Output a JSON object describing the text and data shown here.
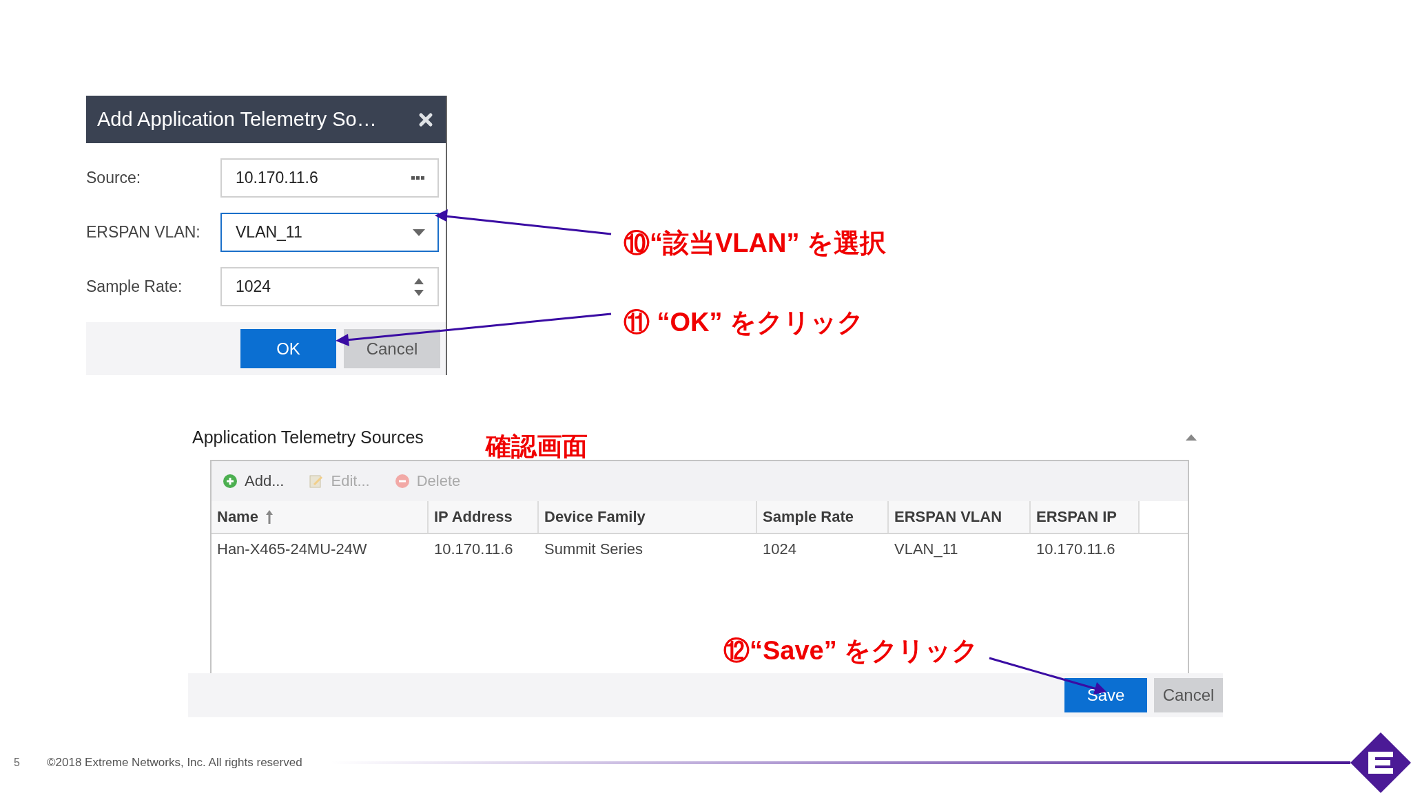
{
  "dialog": {
    "title": "Add Application Telemetry So…",
    "fields": [
      {
        "kind": "picker",
        "label": "Source:",
        "value": "10.170.11.6",
        "focused": false
      },
      {
        "kind": "dropdown",
        "label": "ERSPAN VLAN:",
        "value": "VLAN_11",
        "focused": true
      },
      {
        "kind": "spinner",
        "label": "Sample Rate:",
        "value": "1024",
        "focused": false
      }
    ],
    "buttons": [
      {
        "label": "OK",
        "primary": true
      },
      {
        "label": "Cancel",
        "primary": false
      }
    ]
  },
  "annotations": [
    {
      "text": "⑩“該当VLAN” を選択"
    },
    {
      "text": "⑪ “OK” をクリック"
    },
    {
      "text": "⑫“Save” をクリック"
    }
  ],
  "panel": {
    "title": "Application Telemetry Sources",
    "note": "確認画面",
    "toolbar": [
      {
        "kind": "add",
        "label": "Add...",
        "disabled": false
      },
      {
        "kind": "edit",
        "label": "Edit...",
        "disabled": true
      },
      {
        "kind": "delete",
        "label": "Delete",
        "disabled": true
      }
    ],
    "columns": [
      {
        "label": "Name",
        "sorted": true
      },
      {
        "label": "IP Address",
        "sorted": false
      },
      {
        "label": "Device Family",
        "sorted": false
      },
      {
        "label": "Sample Rate",
        "sorted": false
      },
      {
        "label": "ERSPAN VLAN",
        "sorted": false
      },
      {
        "label": "ERSPAN IP",
        "sorted": false
      }
    ],
    "rows": [
      [
        "Han-X465-24MU-24W",
        "10.170.11.6",
        "Summit Series",
        "1024",
        "VLAN_11",
        "10.170.11.6"
      ]
    ],
    "buttons": [
      {
        "label": "Save",
        "primary": true
      },
      {
        "label": "Cancel",
        "primary": false
      }
    ]
  },
  "footer": {
    "page": "5",
    "copyright": "©2018 Extreme Networks, Inc.  All rights reserved"
  }
}
